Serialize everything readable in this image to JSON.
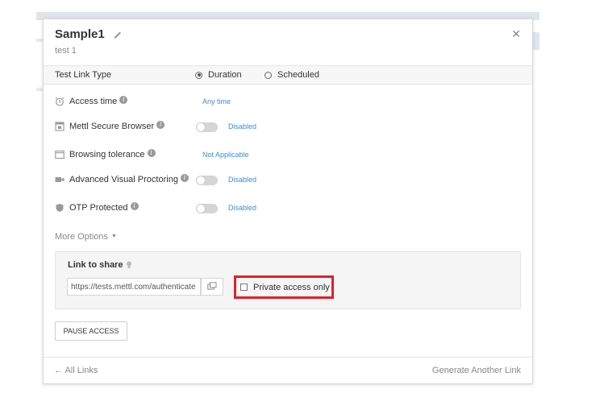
{
  "header": {
    "title": "Sample1",
    "subtitle": "test 1"
  },
  "link_type": {
    "label": "Test Link Type",
    "options": [
      {
        "label": "Duration",
        "selected": true
      },
      {
        "label": "Scheduled",
        "selected": false
      }
    ]
  },
  "settings": [
    {
      "label": "Access time",
      "value": "Any time",
      "toggle": false
    },
    {
      "label": "Mettl Secure Browser",
      "value": "Disabled",
      "toggle": true
    },
    {
      "label": "Browsing tolerance",
      "value": "Not Applicable",
      "toggle": false
    },
    {
      "label": "Advanced Visual Proctoring",
      "value": "Disabled",
      "toggle": true
    },
    {
      "label": "OTP Protected",
      "value": "Disabled",
      "toggle": true
    }
  ],
  "more_options": "More Options",
  "share": {
    "title": "Link to share",
    "url": "https://tests.mettl.com/authenticate",
    "private_label": "Private access only",
    "private_checked": false
  },
  "pause_label": "PAUSE ACCESS",
  "footer": {
    "back_label": "← All Links",
    "generate_label": "Generate Another Link"
  },
  "colors": {
    "accent": "#3a8fd6",
    "highlight": "#e0202a"
  }
}
